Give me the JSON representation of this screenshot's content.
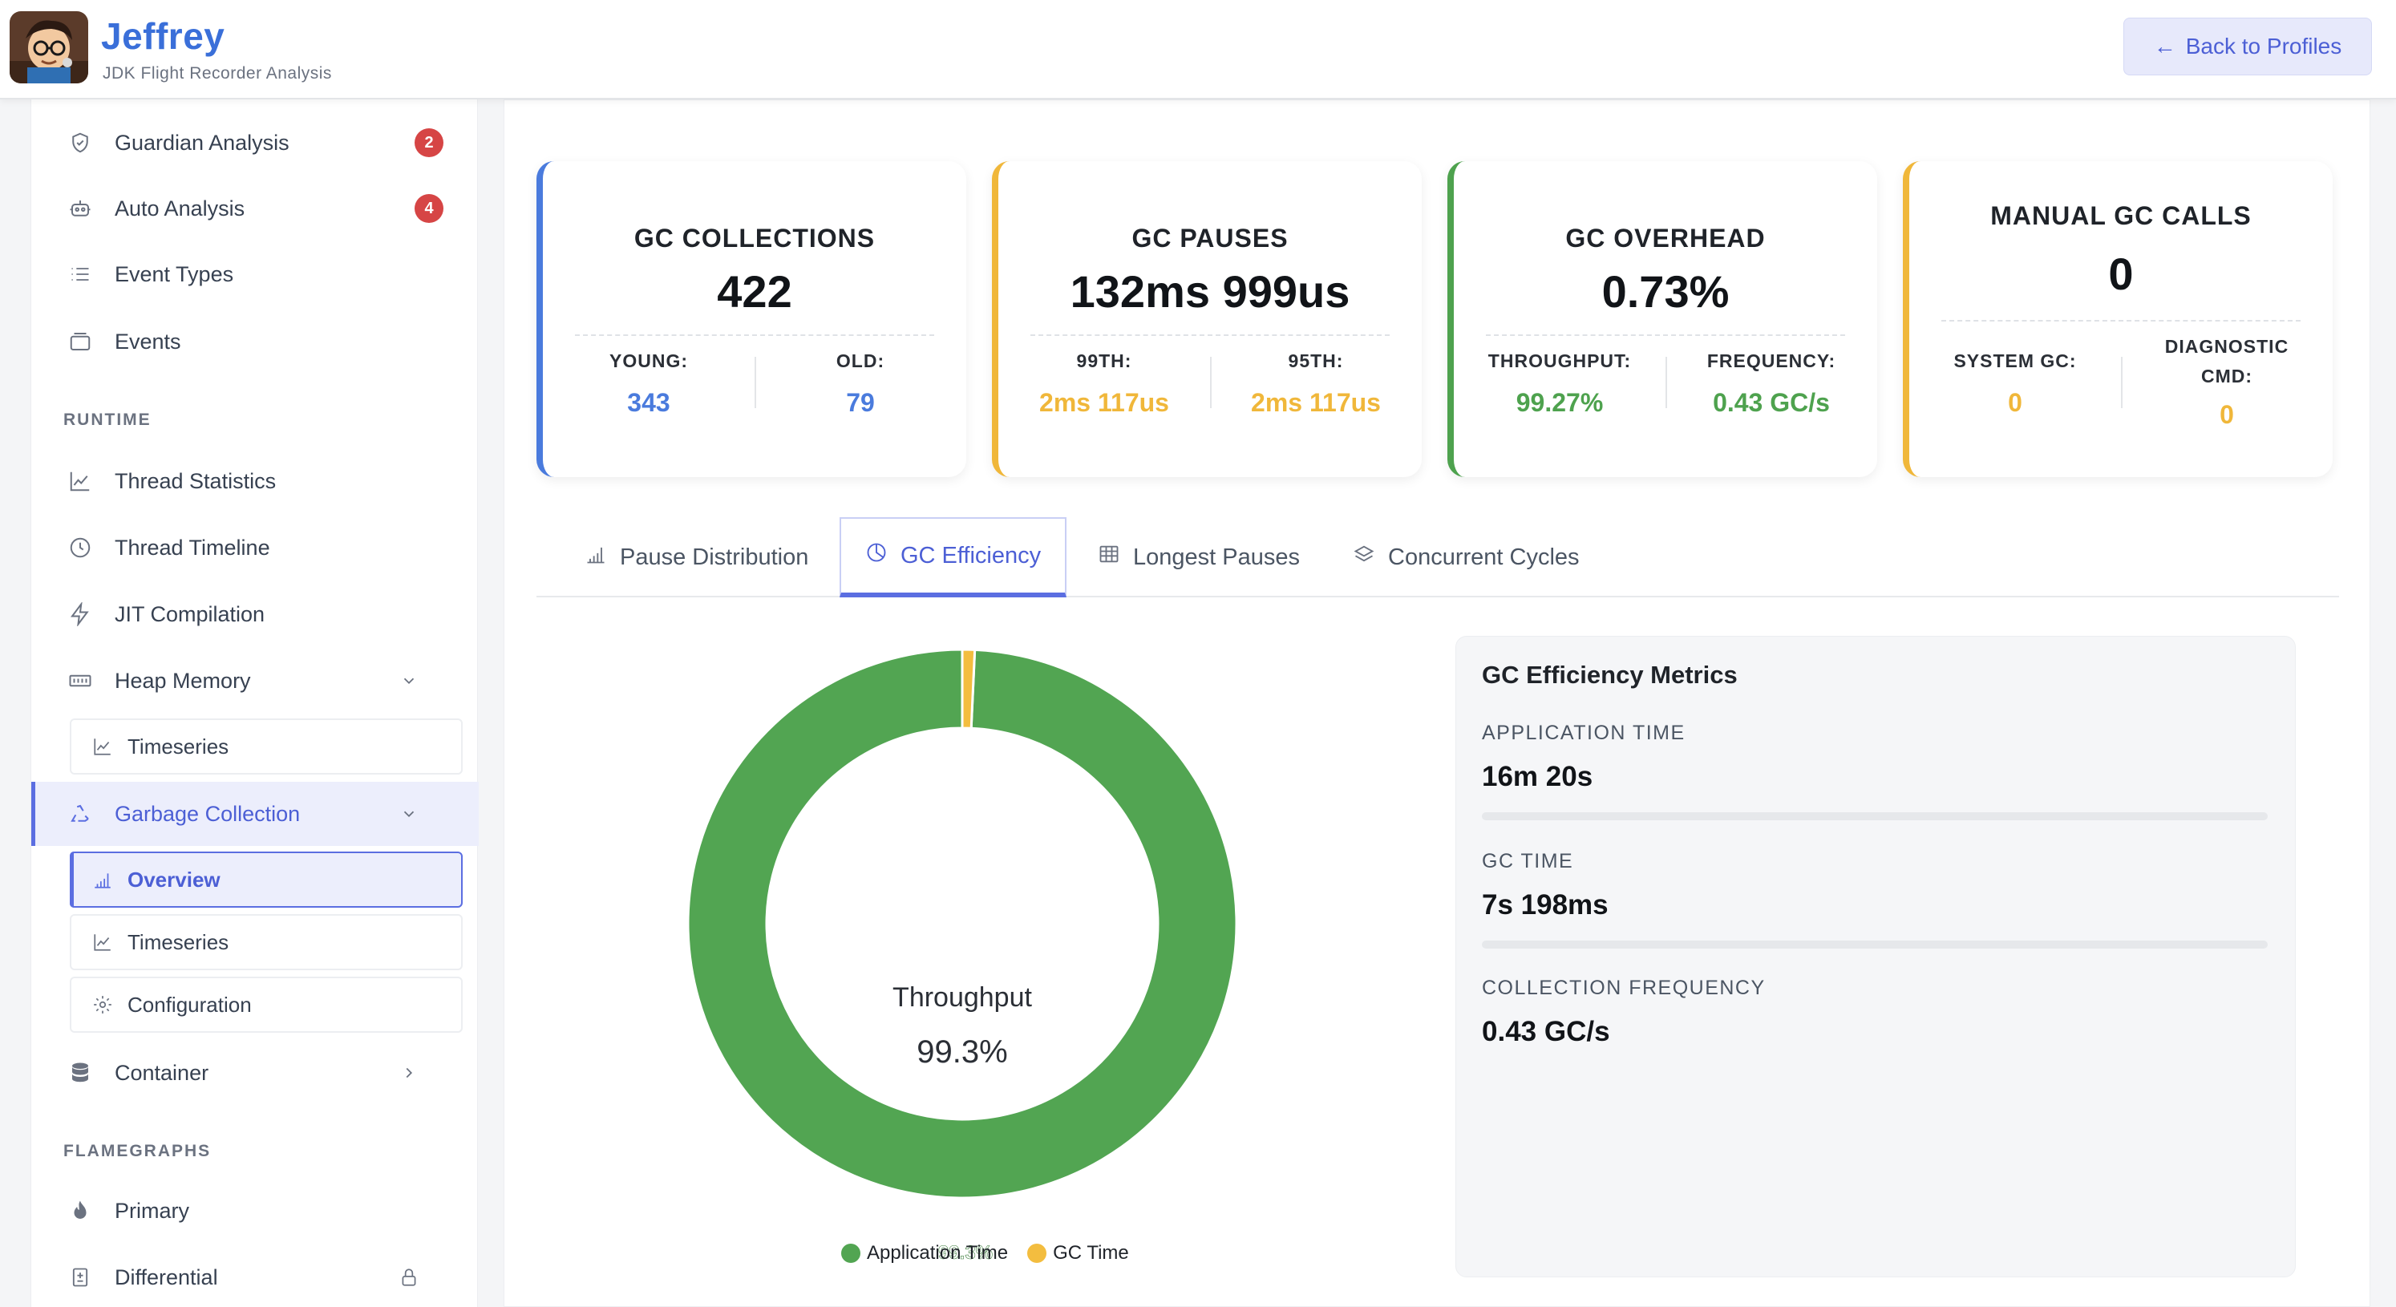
{
  "app": {
    "title": "Jeffrey",
    "subtitle": "JDK Flight Recorder Analysis",
    "back_button": "Back to Profiles",
    "back_arrow": "←"
  },
  "sidebar": {
    "items_top": [
      {
        "label": "Guardian Analysis",
        "icon": "shield-icon",
        "badge": "2"
      },
      {
        "label": "Auto Analysis",
        "icon": "robot-icon",
        "badge": "4"
      },
      {
        "label": "Event Types",
        "icon": "list-icon"
      },
      {
        "label": "Events",
        "icon": "inbox-icon"
      }
    ],
    "runtime_section": "RUNTIME",
    "runtime_items": [
      {
        "label": "Thread Statistics",
        "icon": "line-chart-icon"
      },
      {
        "label": "Thread Timeline",
        "icon": "clock-icon"
      },
      {
        "label": "JIT Compilation",
        "icon": "lightning-icon"
      },
      {
        "label": "Heap Memory",
        "icon": "memory-icon"
      }
    ],
    "heap_sub": [
      {
        "label": "Timeseries",
        "icon": "line-chart-icon"
      }
    ],
    "gc_item": {
      "label": "Garbage Collection",
      "icon": "recycle-icon"
    },
    "gc_sub": [
      {
        "label": "Overview",
        "icon": "bar-chart-icon"
      },
      {
        "label": "Timeseries",
        "icon": "line-chart-icon"
      },
      {
        "label": "Configuration",
        "icon": "gear-icon"
      }
    ],
    "container_item": {
      "label": "Container",
      "icon": "database-icon"
    },
    "flamegraphs_section": "FLAMEGRAPHS",
    "flame_items": [
      {
        "label": "Primary",
        "icon": "flame-icon"
      },
      {
        "label": "Differential",
        "icon": "diff-file-icon"
      }
    ]
  },
  "cards": [
    {
      "title": "GC COLLECTIONS",
      "value": "422",
      "color": "#4a7bdd",
      "left_label": "YOUNG:",
      "left_value": "343",
      "right_label": "OLD:",
      "right_value": "79"
    },
    {
      "title": "GC PAUSES",
      "value": "132ms 999us",
      "color": "#f0b73a",
      "left_label": "99TH:",
      "left_value": "2ms 117us",
      "right_label": "95TH:",
      "right_value": "2ms 117us"
    },
    {
      "title": "GC OVERHEAD",
      "value": "0.73%",
      "color": "#4ea24e",
      "left_label": "THROUGHPUT:",
      "left_value": "99.27%",
      "right_label": "FREQUENCY:",
      "right_value": "0.43 GC/s"
    },
    {
      "title": "MANUAL GC CALLS",
      "value": "0",
      "color": "#f0b73a",
      "left_label": "SYSTEM GC:",
      "left_value": "0",
      "right_label_1": "DIAGNOSTIC",
      "right_label_2": "CMD:",
      "right_value": "0"
    }
  ],
  "tabs": [
    {
      "label": "Pause Distribution",
      "icon": "bar-chart-icon"
    },
    {
      "label": "GC Efficiency",
      "icon": "pie-chart-icon",
      "active": true
    },
    {
      "label": "Longest Pauses",
      "icon": "table-icon"
    },
    {
      "label": "Concurrent Cycles",
      "icon": "layers-icon"
    }
  ],
  "chart_data": {
    "type": "pie",
    "center_title": "Throughput",
    "center_value": "99.3%",
    "slice_label": "99.3%",
    "categories": [
      "Application Time",
      "GC Time"
    ],
    "values": [
      99.27,
      0.73
    ],
    "colors": [
      "#52a552",
      "#f3bd3f"
    ]
  },
  "metrics": {
    "heading": "GC Efficiency Metrics",
    "items": [
      {
        "label": "APPLICATION TIME",
        "value": "16m 20s"
      },
      {
        "label": "GC TIME",
        "value": "7s 198ms"
      },
      {
        "label": "COLLECTION FREQUENCY",
        "value": "0.43 GC/s"
      }
    ]
  }
}
